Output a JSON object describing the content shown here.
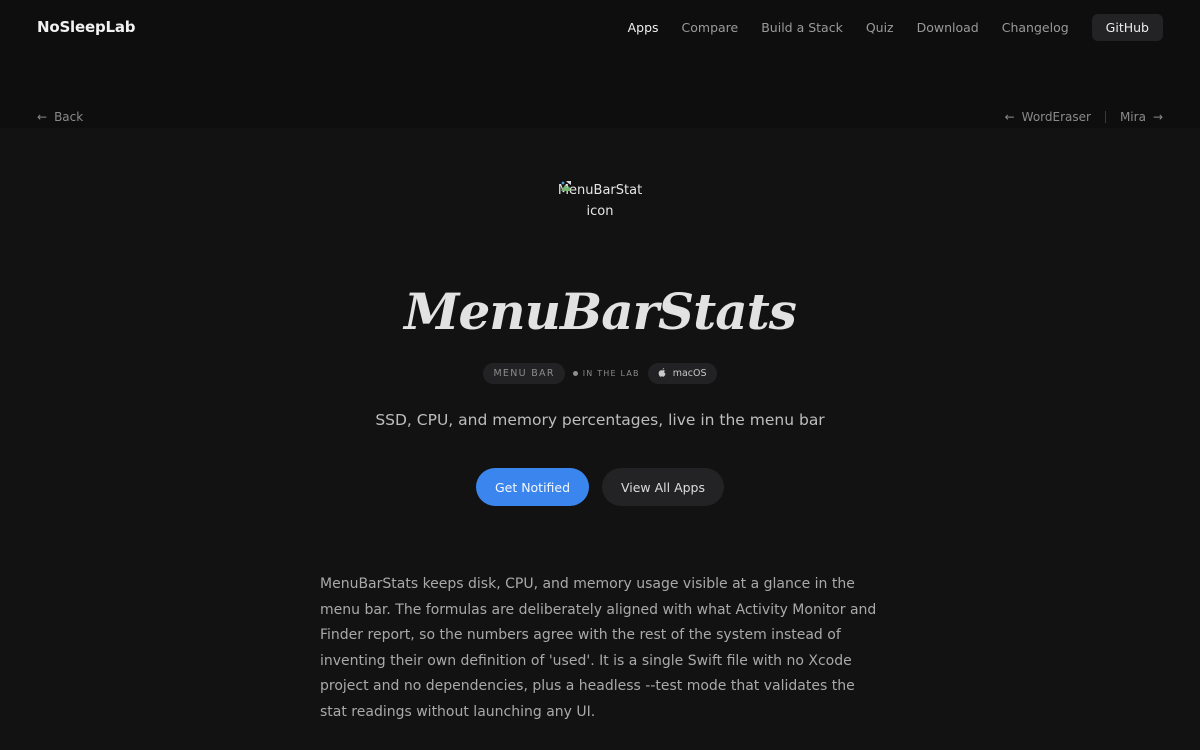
{
  "nav": {
    "brand": "NoSleepLab",
    "links": [
      "Apps",
      "Compare",
      "Build a Stack",
      "Quiz",
      "Download",
      "Changelog"
    ],
    "github_label": "GitHub"
  },
  "subnav": {
    "back_label": "Back",
    "prev_label": "WordEraser",
    "next_label": "Mira"
  },
  "app": {
    "icon_alt_line1": "MenuBarStat",
    "icon_alt_line2": "icon",
    "title": "MenuBarStats",
    "category_tag": "MENU BAR",
    "status_tag": "IN THE LAB",
    "platform_tag": "macOS",
    "tagline": "SSD, CPU, and memory percentages, live in the menu bar",
    "primary_cta": "Get Notified",
    "secondary_cta": "View All Apps",
    "description": "MenuBarStats keeps disk, CPU, and memory usage visible at a glance in the menu bar. The formulas are deliberately aligned with what Activity Monitor and Finder report, so the numbers agree with the rest of the system instead of inventing their own definition of 'used'. It is a single Swift file with no Xcode project and no dependencies, plus a headless --test mode that validates the stat readings without launching any UI."
  },
  "colors": {
    "background": "#0e0e0f",
    "accent": "#3b86ee"
  },
  "icons": [
    "arrow-left-icon",
    "arrow-right-icon",
    "broken-image-icon",
    "apple-icon"
  ]
}
